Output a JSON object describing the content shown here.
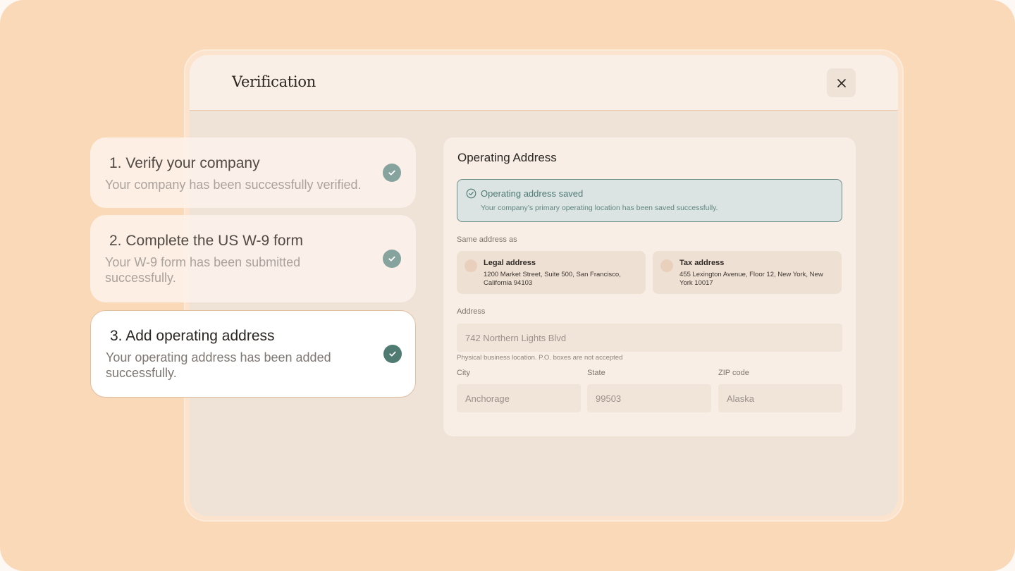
{
  "window": {
    "title": "Verification"
  },
  "steps": [
    {
      "title": "1. Verify your company",
      "description": "Your company has been successfully verified.",
      "status": "completed"
    },
    {
      "title": "2. Complete the US W-9 form",
      "description": "Your W-9 form has been submitted successfully.",
      "status": "completed"
    },
    {
      "title": "3. Add operating address",
      "description": "Your operating address has been added successfully.",
      "status": "completed"
    }
  ],
  "panel": {
    "title": "Operating Address",
    "alert": {
      "title": "Operating address saved",
      "message": "Your company’s primary operating location has been saved successfully."
    },
    "same_address_label": "Same address as",
    "options": [
      {
        "title": "Legal address",
        "address": "1200 Market Street, Suite 500, San Francisco, California 94103"
      },
      {
        "title": "Tax address",
        "address": "455 Lexington Avenue, Floor 12, New York, New York 10017"
      }
    ],
    "address_label": "Address",
    "address_value": "742 Northern Lights Blvd",
    "address_hint": "Physical business location. P.O. boxes are not accepted",
    "city_label": "City",
    "city_value": "Anchorage",
    "state_label": "State",
    "state_value": "99503",
    "zip_label": "ZIP code",
    "zip_value": "Alaska"
  },
  "colors": {
    "background": "#fad9b9",
    "accent": "#4f7b72",
    "success_bg": "#dce3e3"
  },
  "icons": {
    "close": "close-icon",
    "check": "check-icon",
    "alert": "check-circle-icon"
  }
}
